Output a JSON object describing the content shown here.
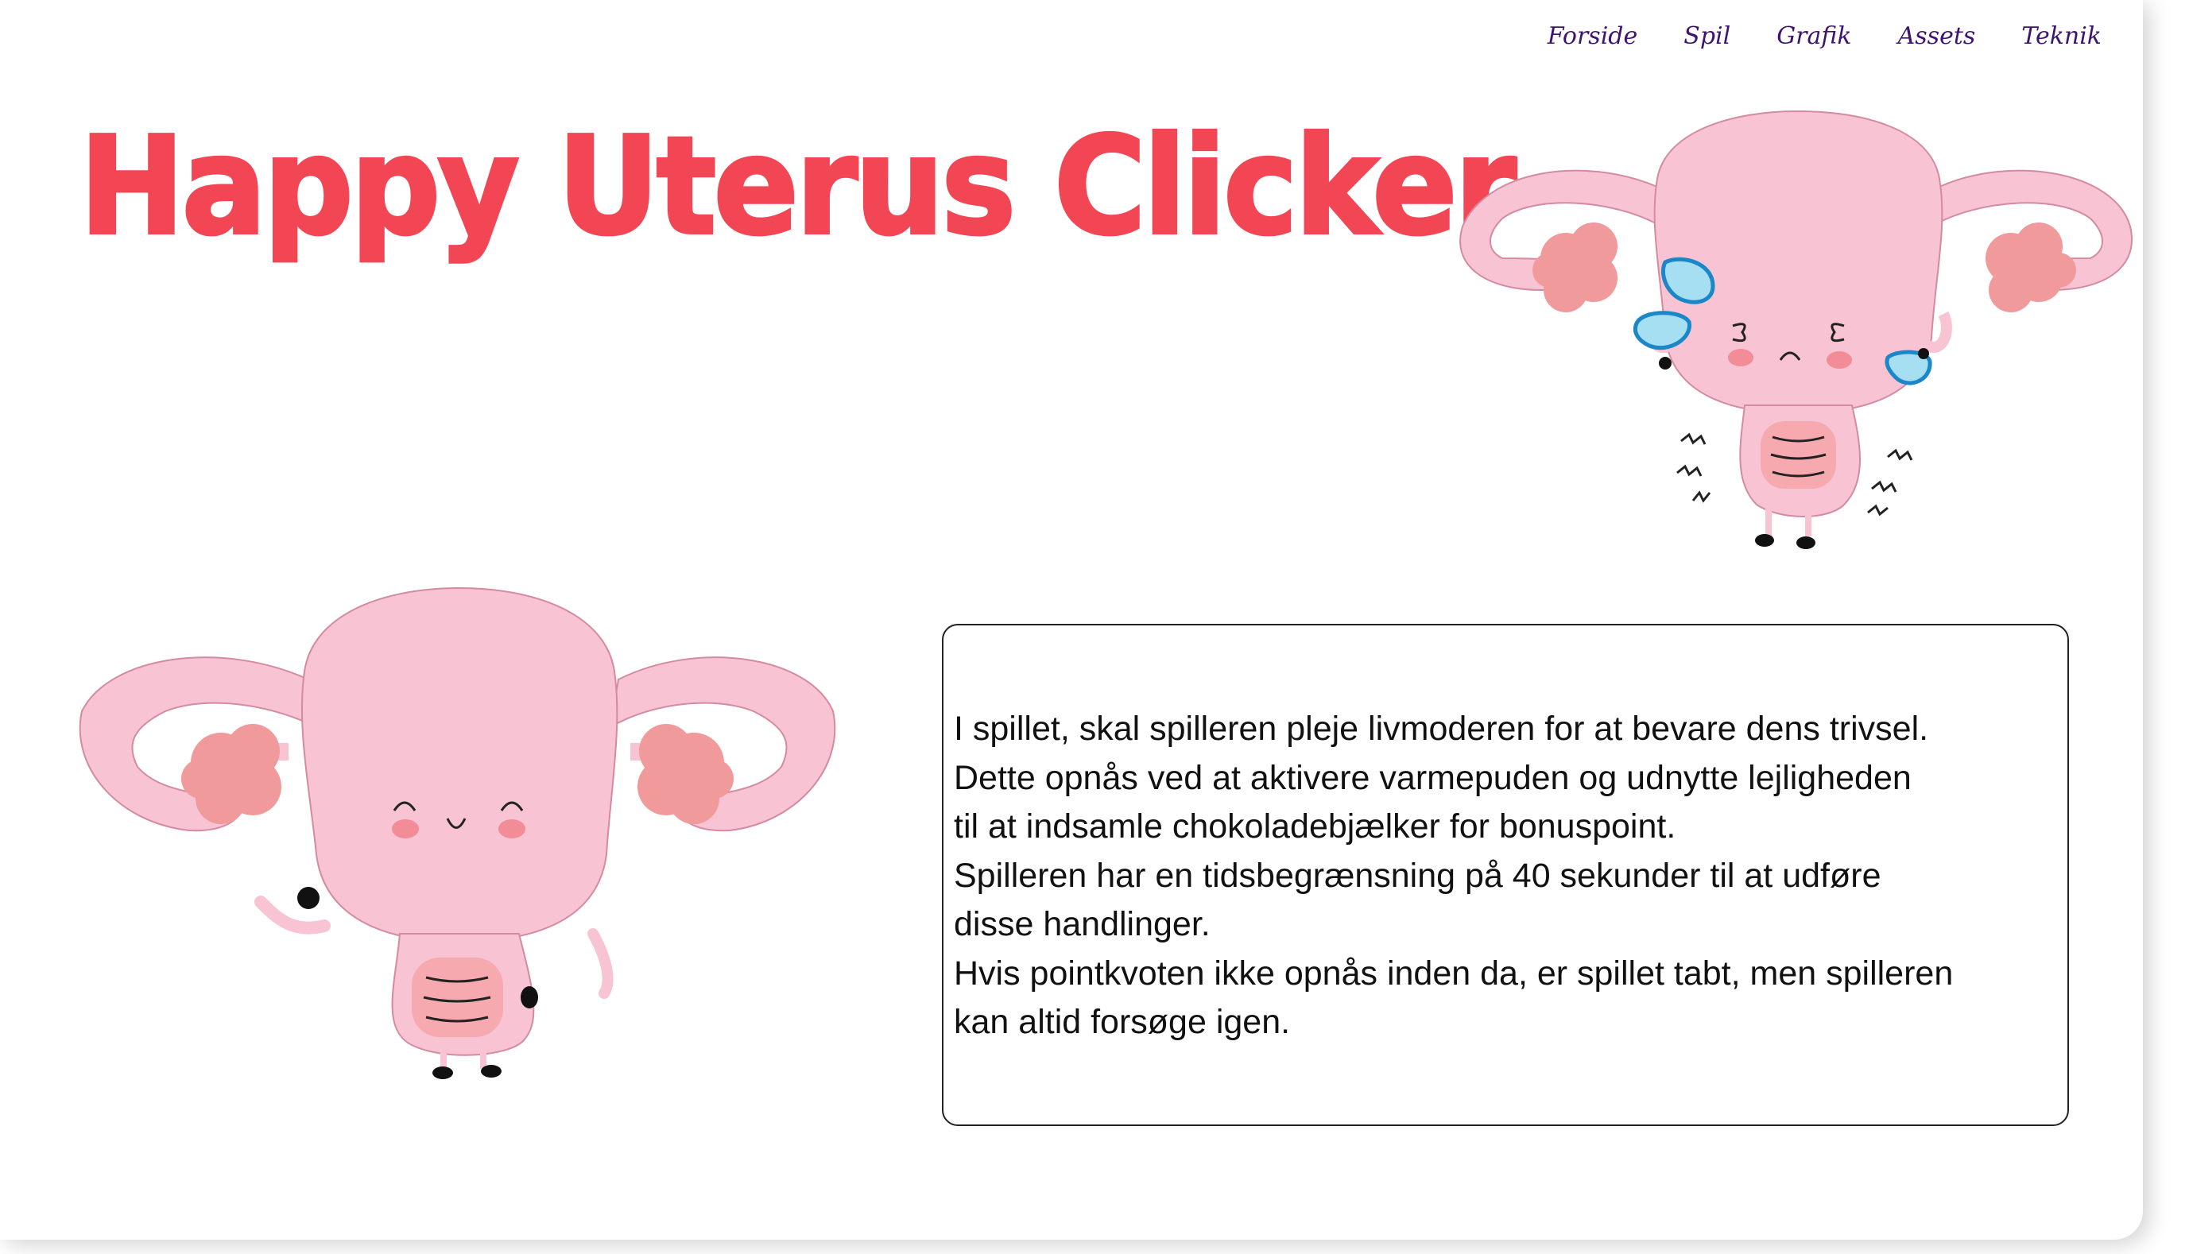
{
  "nav": {
    "items": [
      "Forside",
      "Spil",
      "Grafik",
      "Assets",
      "Teknik"
    ]
  },
  "header": {
    "title": "Happy Uterus Clicker"
  },
  "info": {
    "lines": [
      "I spillet, skal spilleren pleje livmoderen for at bevare dens trivsel.",
      "Dette opnås ved at aktivere varmepuden og udnytte lejligheden",
      "til at indsamle chokoladebjælker for bonuspoint.",
      "Spilleren har en tidsbegrænsning på 40 sekunder til at udføre",
      "disse handlinger.",
      "Hvis pointkvoten ikke opnås inden da, er spillet tabt, men spilleren",
      "kan altid forsøge igen."
    ]
  },
  "colors": {
    "title": "#f24655",
    "nav_link": "#3d1470",
    "uterus_body": "#f8c4d4",
    "uterus_outline": "#d48aa0",
    "ovary": "#f09a9c",
    "tear": "#a6dff2",
    "tear_outline": "#1b86c8"
  },
  "mascots": [
    {
      "name": "crying-uterus-illustration",
      "mood": "crying"
    },
    {
      "name": "happy-uterus-illustration",
      "mood": "happy-waving"
    }
  ]
}
